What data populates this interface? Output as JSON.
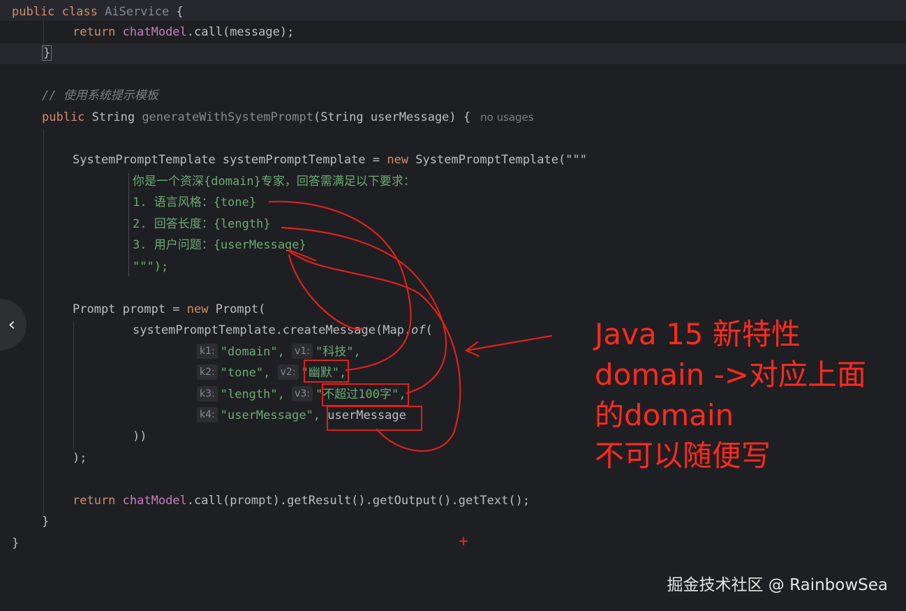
{
  "code": {
    "line1": {
      "kw": "public class ",
      "cls": "AiService",
      "rest": " {"
    },
    "line2": {
      "kw": "return ",
      "field": "chatModel",
      "rest": ".call(message);"
    },
    "line3": {
      "text": "}"
    },
    "line4": {
      "comment": "// 使用系统提示模板"
    },
    "line5": {
      "kw": "public ",
      "type": "String ",
      "fn": "generateWithSystemPrompt",
      "params": "(String userMessage) {",
      "usage": "no usages"
    },
    "line6": {
      "text": "SystemPromptTemplate systemPromptTemplate = ",
      "kw": "new",
      "rest": " SystemPromptTemplate(\"\"\""
    },
    "line7": {
      "text": "你是一个资深{domain}专家，回答需满足以下要求："
    },
    "line8": {
      "text": "1. 语言风格：{tone}"
    },
    "line9": {
      "text": "2. 回答长度：{length}"
    },
    "line10": {
      "text": "3. 用户问题：{userMessage}"
    },
    "line11": {
      "text": "\"\"\");"
    },
    "line12": {
      "text": "Prompt prompt = ",
      "kw": "new",
      "rest": " Prompt("
    },
    "line13": {
      "text": "systemPromptTemplate.createMessage(Map.",
      "italic": "of",
      "rest": "("
    },
    "line14": {
      "k": "k1:",
      "key": "\"domain\",",
      "v": "v1:",
      "val": "\"科技\","
    },
    "line15": {
      "k": "k2:",
      "key": "\"tone\",",
      "v": "v2:",
      "val": "\"幽默\","
    },
    "line16": {
      "k": "k3:",
      "key": "\"length\",",
      "v": "v3:",
      "val": "\"不超过100字\","
    },
    "line17": {
      "k": "k4:",
      "key": "\"userMessage\",",
      "val": "userMessage"
    },
    "line18": {
      "text": "))"
    },
    "line19": {
      "text": ");"
    },
    "line20": {
      "kw": "return ",
      "field": "chatModel",
      "rest": ".call(prompt).getResult().getOutput().getText();"
    },
    "line21": {
      "text": "}"
    },
    "line22": {
      "text": "}"
    }
  },
  "annotation": {
    "line1": "Java 15 新特性",
    "line2": "domain ->对应上面",
    "line3": "的domain",
    "line4": "不可以随便写"
  },
  "watermark": "掘金技术社区 @ RainbowSea",
  "nav": {
    "icon": "chevron-left-icon",
    "glyph": "‹"
  },
  "colors": {
    "background": "#1e1f22",
    "keyword": "#cf8e6d",
    "string": "#6aab73",
    "annotation": "#ff2a1f"
  }
}
